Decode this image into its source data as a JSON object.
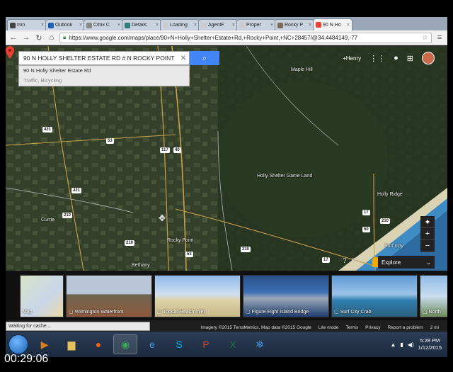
{
  "tabs": [
    {
      "label": "min",
      "icon": "bookmark-icon",
      "color": "#444444"
    },
    {
      "label": "Outlook",
      "icon": "outlook-icon",
      "color": "#1f5fb4"
    },
    {
      "label": "Citrix C",
      "icon": "citrix-icon",
      "color": "#888888"
    },
    {
      "label": "Details",
      "icon": "details-icon",
      "color": "#2e7d7b"
    },
    {
      "label": "Loading",
      "icon": "loading-icon",
      "color": "#cccccc"
    },
    {
      "label": "AgentF",
      "icon": "page-icon",
      "color": "#cccccc"
    },
    {
      "label": "Proper",
      "icon": "page-icon",
      "color": "#cccccc"
    },
    {
      "label": "Rocky P",
      "icon": "house-icon",
      "color": "#7a6a55"
    },
    {
      "label": "90 N Ho",
      "icon": "google-maps-icon",
      "color": "#e94235",
      "active": true
    }
  ],
  "toolbar": {
    "url": "https://www.google.com/maps/place/90+N+Holly+Shelter+Estate+Rd,+Rocky+Point,+NC+28457/@34.4484149,-77"
  },
  "search": {
    "value": "90 N HOLLY SHELTER ESTATE RD # N ROCKY POINT",
    "suggestions": [
      "90 N Holly Shelter Estate Rd",
      "Traffic, Bicycling"
    ]
  },
  "account": {
    "name": "+Henry"
  },
  "map": {
    "labels": [
      "Maple Hill",
      "Holly Shelter Game Land",
      "Holly Ridge",
      "Rocky Point",
      "Currie",
      "Surf City",
      "Bethany"
    ],
    "shields": [
      "421",
      "53",
      "117",
      "40",
      "421",
      "210",
      "210",
      "210",
      "50",
      "17",
      "210",
      "17",
      "53"
    ]
  },
  "controls": {
    "explore": "Explore",
    "zoom_in": "+",
    "zoom_out": "−"
  },
  "photos": [
    {
      "label": "Map",
      "kind": "map"
    },
    {
      "label": "Wilmington Waterfront",
      "kind": "photo"
    },
    {
      "label": "Topsail Beach Inlet",
      "kind": "photo"
    },
    {
      "label": "Figure Eight Island Bridge",
      "kind": "photo"
    },
    {
      "label": "Surf City Crab",
      "kind": "photo"
    },
    {
      "label": "North",
      "kind": "photo"
    }
  ],
  "footer": [
    "Imagery ©2015 TerraMetrics, Map data ©2015 Google",
    "Lite mode",
    "Terms",
    "Privacy",
    "Report a problem",
    "2 mi"
  ],
  "status": "Waiting for cache...",
  "taskbar": {
    "apps": [
      {
        "name": "media-player-icon",
        "glyph": "▶",
        "color": "#e07b1a"
      },
      {
        "name": "folder-icon",
        "glyph": "▆",
        "color": "#e5c15b"
      },
      {
        "name": "firefox-icon",
        "glyph": "●",
        "color": "#e8620f"
      },
      {
        "name": "chrome-icon",
        "glyph": "◉",
        "color": "#3aa757",
        "open": true
      },
      {
        "name": "ie-icon",
        "glyph": "e",
        "color": "#3b9ae0"
      },
      {
        "name": "skype-icon",
        "glyph": "S",
        "color": "#00aff0"
      },
      {
        "name": "powerpoint-icon",
        "glyph": "P",
        "color": "#d24726"
      },
      {
        "name": "excel-icon",
        "glyph": "X",
        "color": "#1e7145"
      },
      {
        "name": "snowflake-app-icon",
        "glyph": "❄",
        "color": "#4a90e2"
      }
    ],
    "time": "5:28 PM",
    "date": "1/12/2015"
  },
  "elapsed": "00:29:06"
}
